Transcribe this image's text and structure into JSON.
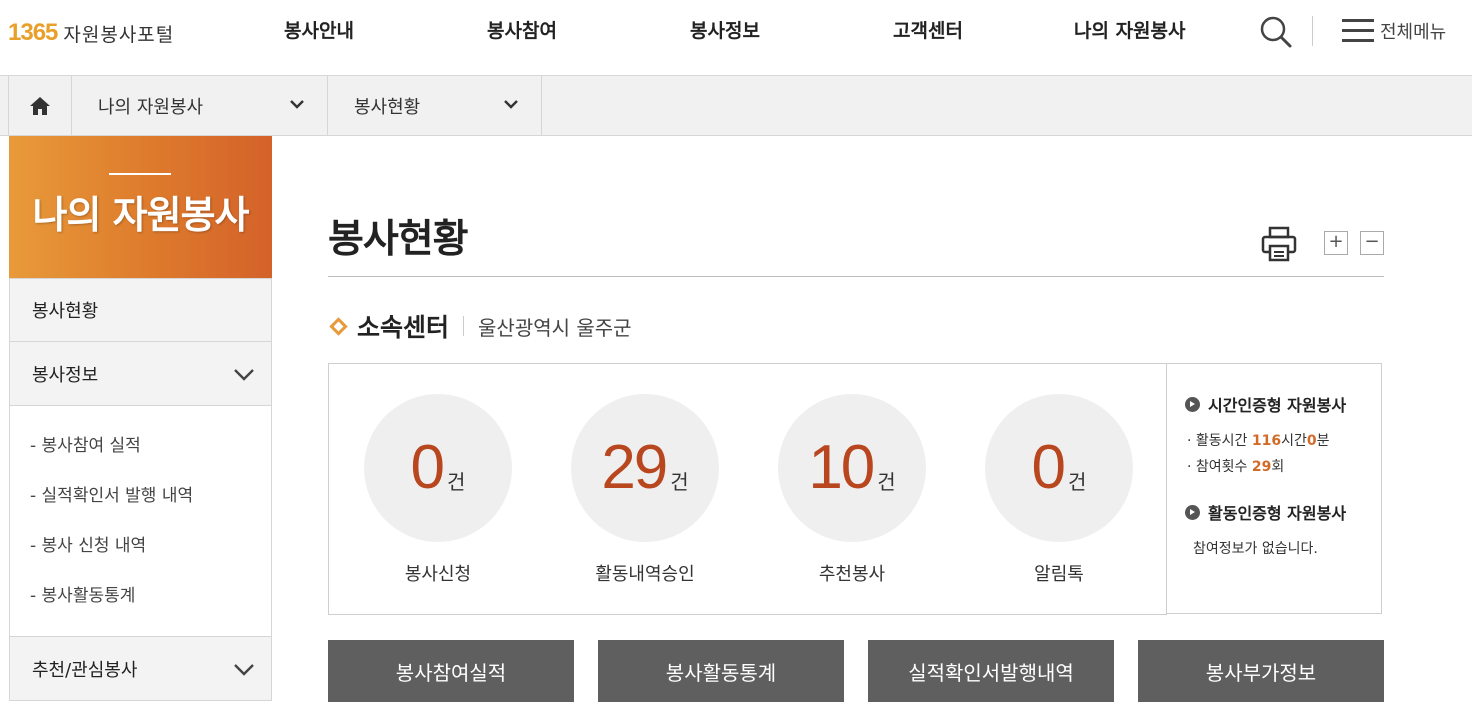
{
  "header": {
    "logo_number": "1365",
    "logo_text": "자원봉사포털",
    "nav": [
      "봉사안내",
      "봉사참여",
      "봉사정보",
      "고객센터",
      "나의 자원봉사"
    ],
    "all_menu_label": "전체메뉴"
  },
  "location": {
    "level1": "나의 자원봉사",
    "level2": "봉사현황"
  },
  "sidebar": {
    "title": "나의 자원봉사",
    "items": [
      {
        "label": "봉사현황"
      },
      {
        "label": "봉사정보",
        "sub": [
          "- 봉사참여 실적",
          "- 실적확인서 발행 내역",
          "- 봉사 신청 내역",
          "- 봉사활동통계"
        ]
      },
      {
        "label": "추천/관심봉사"
      }
    ]
  },
  "main": {
    "title": "봉사현황",
    "zoom_in": "+",
    "zoom_out": "−",
    "center_label": "소속센터",
    "center_value": "울산광역시 울주군",
    "stats": [
      {
        "value": "0",
        "unit": "건",
        "label": "봉사신청"
      },
      {
        "value": "29",
        "unit": "건",
        "label": "활동내역승인"
      },
      {
        "value": "10",
        "unit": "건",
        "label": "추천봉사"
      },
      {
        "value": "0",
        "unit": "건",
        "label": "알림톡"
      }
    ],
    "info": {
      "time_heading": "시간인증형 자원봉사",
      "time_line1_prefix": "· 활동시간 ",
      "hours": "116",
      "hours_unit": "시간",
      "minutes": "0",
      "minutes_unit": "분",
      "count_prefix": "· 참여횟수 ",
      "count": "29",
      "count_unit": "회",
      "activity_heading": "활동인증형 자원봉사",
      "activity_text": "참여정보가 없습니다."
    },
    "buttons": [
      "봉사참여실적",
      "봉사활동통계",
      "실적확인서발행내역",
      "봉사부가정보"
    ]
  },
  "colors": {
    "accent": "#dd7a2c",
    "number": "#b8471f",
    "button_bg": "#5f5f5f"
  }
}
